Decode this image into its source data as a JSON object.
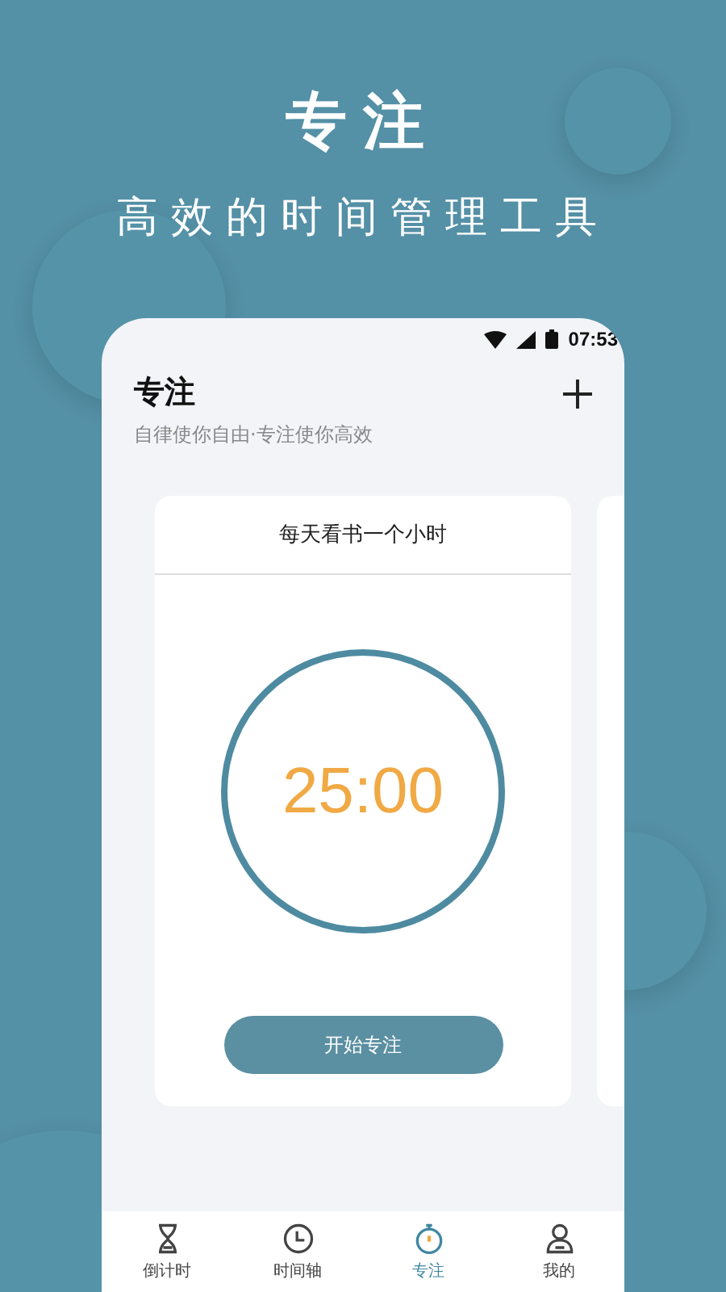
{
  "promo": {
    "headline": "专注",
    "tagline": "高效的时间管理工具"
  },
  "status_bar": {
    "time": "07:53"
  },
  "header": {
    "title": "专注",
    "subtitle": "自律使你自由·专注使你高效"
  },
  "cards": [
    {
      "title": "每天看书一个小时",
      "timer": "25:00",
      "button": "开始专注"
    }
  ],
  "tab_bar": [
    {
      "label": "倒计时",
      "kind": "hourglass",
      "selected": false
    },
    {
      "label": "时间轴",
      "kind": "clock",
      "selected": false
    },
    {
      "label": "专注",
      "kind": "stopwatch",
      "selected": true
    },
    {
      "label": "我的",
      "kind": "person",
      "selected": false
    }
  ]
}
